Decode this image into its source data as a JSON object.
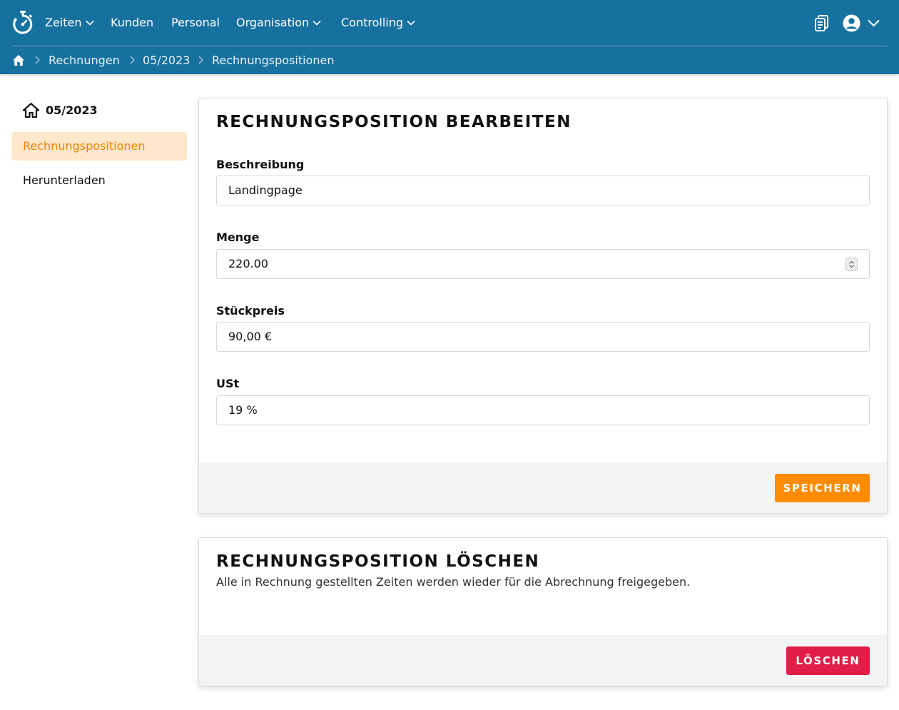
{
  "nav": {
    "items": [
      {
        "label": "Zeiten",
        "dropdown": true
      },
      {
        "label": "Kunden",
        "dropdown": false
      },
      {
        "label": "Personal",
        "dropdown": false
      },
      {
        "label": "Organisation",
        "dropdown": true
      },
      {
        "label": "Controlling",
        "dropdown": true
      }
    ],
    "icons": [
      "stopwatch-logo-icon",
      "clipboard-icon",
      "user-circle-icon",
      "chevron-down-icon"
    ]
  },
  "breadcrumb": [
    "Rechnungen",
    "05/2023",
    "Rechnungspositionen"
  ],
  "sidebar": {
    "title": "05/2023",
    "items": [
      {
        "label": "Rechnungspositionen",
        "active": true
      },
      {
        "label": "Herunterladen",
        "active": false
      }
    ]
  },
  "edit_card": {
    "title": "RECHNUNGSPOSITION BEARBEITEN",
    "fields": [
      {
        "label": "Beschreibung",
        "value": "Landingpage"
      },
      {
        "label": "Menge",
        "value": "220.00"
      },
      {
        "label": "Stückpreis",
        "value": "90,00 €"
      },
      {
        "label": "USt",
        "value": "19 %"
      }
    ],
    "save_label": "SPEICHERN"
  },
  "delete_card": {
    "title": "RECHNUNGSPOSITION LÖSCHEN",
    "description": "Alle in Rechnung gestellten Zeiten werden wieder für die Abrechnung freigegeben.",
    "delete_label": "LÖSCHEN"
  },
  "colors": {
    "header": "#17719f",
    "accent": "#ff8c00",
    "active_bg": "#ffe7cc",
    "danger": "#e11d48",
    "footer_bg": "#f3f4f6"
  }
}
